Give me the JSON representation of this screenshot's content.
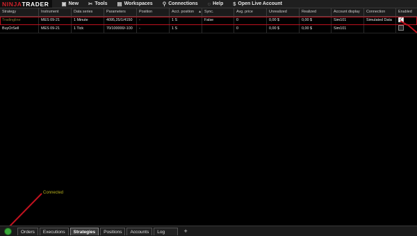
{
  "app": {
    "logo_part1": "NINJA",
    "logo_part2": "TRADER"
  },
  "menu": [
    {
      "label": "New",
      "icon": "new-document-icon",
      "glyph": "▣"
    },
    {
      "label": "Tools",
      "icon": "tools-icon",
      "glyph": "✂"
    },
    {
      "label": "Workspaces",
      "icon": "workspaces-icon",
      "glyph": "▤"
    },
    {
      "label": "Connections",
      "icon": "plug-icon",
      "glyph": "⚲"
    },
    {
      "label": "Help",
      "icon": "help-icon",
      "glyph": "◌"
    },
    {
      "label": "Open Live Account",
      "icon": "dollar-icon",
      "glyph": "$"
    }
  ],
  "grid": {
    "columns": [
      "Strategy",
      "Instrument",
      "Data series",
      "Parameters",
      "Position",
      "Acct. position",
      "Sync.",
      "Avg. price",
      "Unrealized",
      "Realized",
      "Account display",
      "Connection",
      "Enabled"
    ],
    "sorted_column": "Acct. position",
    "rows": [
      {
        "strategy": "Tradingline",
        "instrument": "MES 09-21",
        "data_series": "1 Minute",
        "parameters": "4095,25/1/4150",
        "position": "-",
        "acct_position": "1 S",
        "sync": "False",
        "avg_price": "0",
        "unrealized": "0,00 $",
        "realized": "0,00 $",
        "account": "Sim101",
        "connection": "Simulated Data",
        "enabled": true
      },
      {
        "strategy": "BuyOrSell",
        "instrument": "MES 09-21",
        "data_series": "1 Tick",
        "parameters": "70/100000/-100",
        "position": "-",
        "acct_position": "1 S",
        "sync": "",
        "avg_price": "0",
        "unrealized": "0,00 $",
        "realized": "0,00 $",
        "account": "Sim101",
        "connection": "",
        "enabled": false
      }
    ]
  },
  "status": {
    "connected_label": "Connected",
    "indicator_color": "#39a83a"
  },
  "tabs": [
    "Orders",
    "Executions",
    "Strategies",
    "Positions",
    "Accounts",
    "Log"
  ],
  "active_tab": "Strategies",
  "add_tab_label": "+"
}
